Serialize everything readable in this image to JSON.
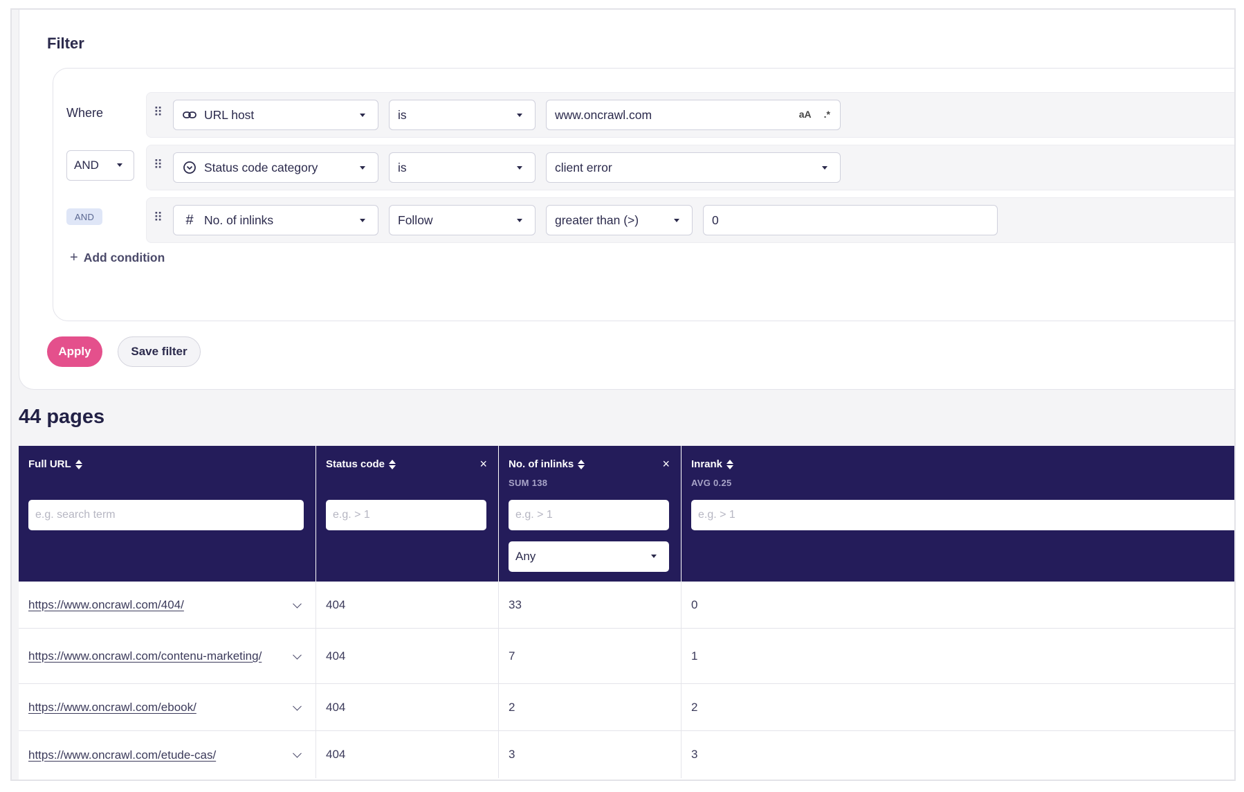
{
  "filter": {
    "title": "Filter",
    "conditions": [
      {
        "connector": "Where",
        "field": "URL host",
        "field_icon": "link-icon",
        "operator": "is",
        "value": "www.oncrawl.com",
        "value_tools": [
          "aA",
          ".*"
        ]
      },
      {
        "connector": "AND",
        "field": "Status code category",
        "field_icon": "circle-chevron-icon",
        "operator": "is",
        "value": "client error"
      },
      {
        "connector": "AND",
        "field": "No. of inlinks",
        "field_icon": "hash-icon",
        "operator": "Follow",
        "comparator": "greater than (>)",
        "value": "0"
      }
    ],
    "add_condition": "Add condition",
    "apply_label": "Apply",
    "save_label": "Save filter"
  },
  "results": {
    "count_label": "44 pages"
  },
  "table": {
    "columns": [
      {
        "title": "Full URL",
        "sub": "",
        "placeholder": "e.g. search term",
        "closable": false
      },
      {
        "title": "Status code",
        "sub": "",
        "placeholder": "e.g. > 1",
        "closable": true
      },
      {
        "title": "No. of inlinks",
        "sub": "SUM 138",
        "placeholder": "e.g. > 1",
        "closable": true,
        "select": "Any"
      },
      {
        "title": "Inrank",
        "sub": "AVG 0.25",
        "placeholder": "e.g. > 1",
        "closable": false
      }
    ],
    "rows": [
      {
        "url": "https://www.oncrawl.com/404/",
        "status": "404",
        "inlinks": "33",
        "inrank": "0"
      },
      {
        "url": "https://www.oncrawl.com/contenu-marketing/",
        "status": "404",
        "inlinks": "7",
        "inrank": "1"
      },
      {
        "url": "https://www.oncrawl.com/ebook/",
        "status": "404",
        "inlinks": "2",
        "inrank": "2"
      },
      {
        "url": "https://www.oncrawl.com/etude-cas/",
        "status": "404",
        "inlinks": "3",
        "inrank": "3"
      }
    ]
  },
  "colors": {
    "header_bg": "#241c5a",
    "apply_bg": "#e4508c",
    "text": "#2b2a4c"
  }
}
